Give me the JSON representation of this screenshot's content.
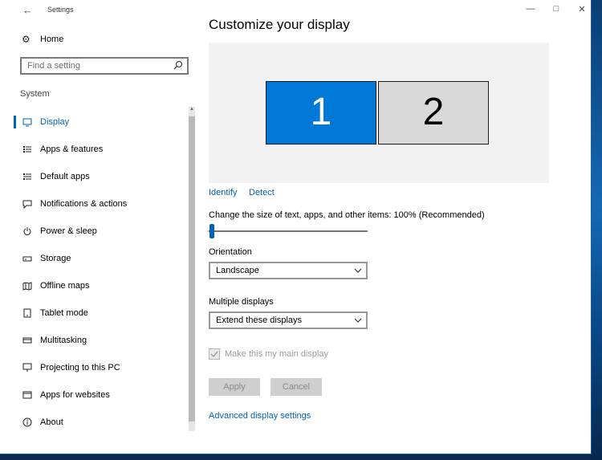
{
  "window": {
    "title": "Settings",
    "back_glyph": "←",
    "minimize_glyph": "—",
    "maximize_glyph": "□",
    "close_glyph": "✕"
  },
  "sidebar": {
    "home_label": "Home",
    "search_placeholder": "Find a setting",
    "section_label": "System",
    "items": [
      {
        "label": "Display",
        "icon": "monitor-icon",
        "selected": true
      },
      {
        "label": "Apps & features",
        "icon": "list-icon"
      },
      {
        "label": "Default apps",
        "icon": "list-default-icon"
      },
      {
        "label": "Notifications & actions",
        "icon": "message-icon"
      },
      {
        "label": "Power & sleep",
        "icon": "power-icon"
      },
      {
        "label": "Storage",
        "icon": "storage-icon"
      },
      {
        "label": "Offline maps",
        "icon": "map-icon"
      },
      {
        "label": "Tablet mode",
        "icon": "tablet-icon"
      },
      {
        "label": "Multitasking",
        "icon": "multitask-icon"
      },
      {
        "label": "Projecting to this PC",
        "icon": "project-icon"
      },
      {
        "label": "Apps for websites",
        "icon": "web-apps-icon"
      },
      {
        "label": "About",
        "icon": "info-icon"
      }
    ]
  },
  "main": {
    "title": "Customize your display",
    "monitors": [
      {
        "label": "1",
        "selected": true
      },
      {
        "label": "2",
        "selected": false
      }
    ],
    "identify_label": "Identify",
    "detect_label": "Detect",
    "scale_label": "Change the size of text, apps, and other items: 100% (Recommended)",
    "scale_value_fraction": 0.0,
    "orientation_label": "Orientation",
    "orientation_value": "Landscape",
    "multiple_label": "Multiple displays",
    "multiple_value": "Extend these displays",
    "main_display_label": "Make this my main display",
    "main_display_checked": true,
    "apply_label": "Apply",
    "cancel_label": "Cancel",
    "advanced_label": "Advanced display settings"
  },
  "colors": {
    "accent": "#0063b1",
    "monitor_selected": "#0078d7",
    "monitor_other": "#d9d9d9"
  }
}
